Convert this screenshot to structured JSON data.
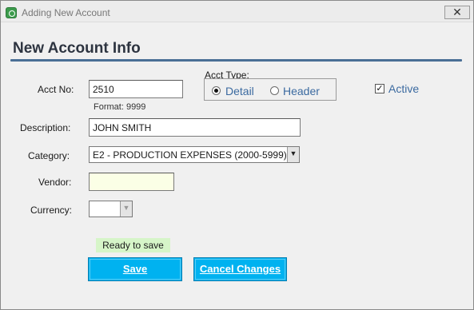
{
  "window": {
    "title": "Adding New Account",
    "close_glyph": "✕",
    "icon": "app-icon"
  },
  "form": {
    "heading": "New Account Info",
    "acct_no": {
      "label": "Acct No:",
      "value": "2510",
      "format_hint": "Format: 9999"
    },
    "acct_type": {
      "label": "Acct Type:",
      "options": [
        {
          "label": "Detail",
          "selected": true
        },
        {
          "label": "Header",
          "selected": false
        }
      ]
    },
    "active": {
      "label": "Active",
      "checked": true,
      "check_glyph": "✓"
    },
    "description": {
      "label": "Description:",
      "value": "JOHN SMITH"
    },
    "category": {
      "label": "Category:",
      "value": "E2 - PRODUCTION EXPENSES (2000-5999)",
      "arrow": "▼"
    },
    "vendor": {
      "label": "Vendor:",
      "value": ""
    },
    "currency": {
      "label": "Currency:",
      "value": "",
      "arrow": "▼"
    }
  },
  "status": {
    "text": "Ready to save",
    "color": "#d6f5c8"
  },
  "buttons": {
    "save": "Save",
    "cancel": "Cancel Changes",
    "color": "#00b2f0"
  },
  "colors": {
    "heading_rule": "#4a6f96",
    "link_label": "#3b6aa0"
  }
}
